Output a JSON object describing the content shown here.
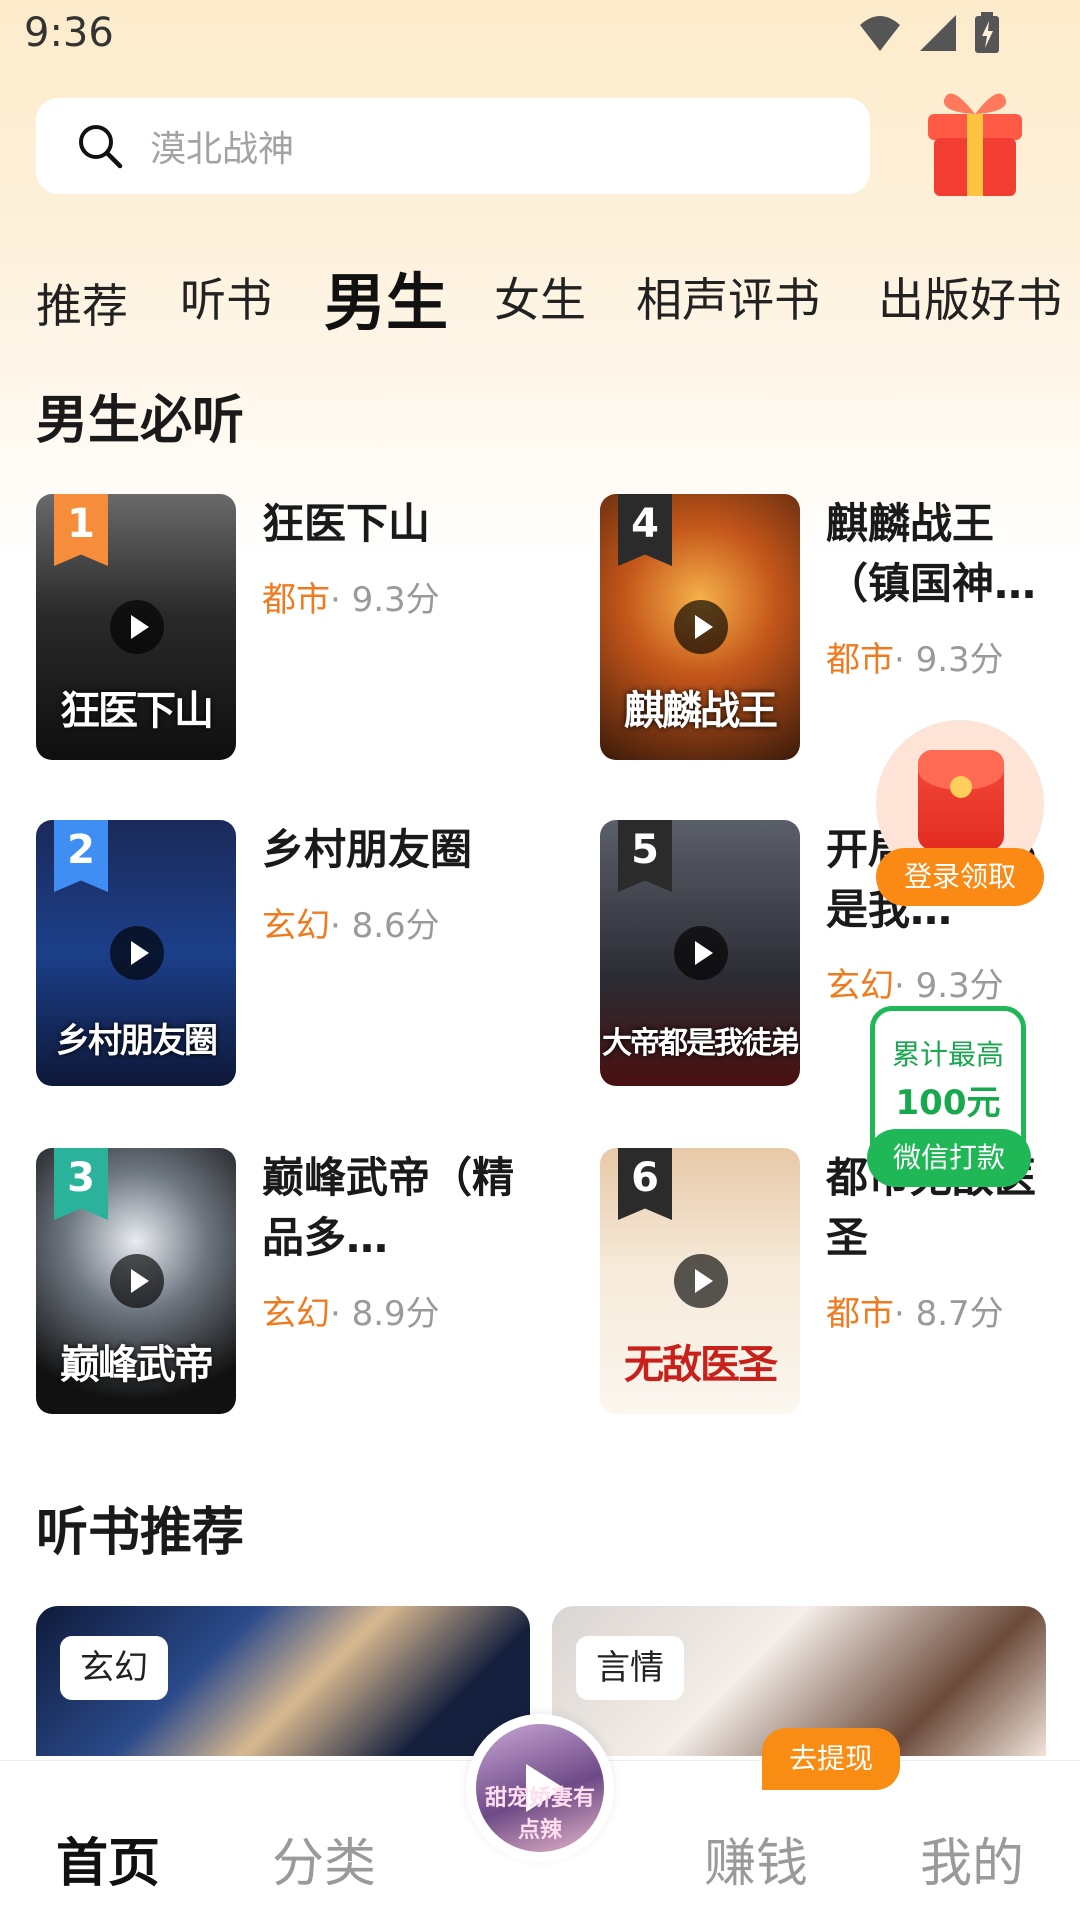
{
  "status_bar": {
    "time": "9:36"
  },
  "search": {
    "placeholder": "漠北战神"
  },
  "tabs": [
    "推荐",
    "听书",
    "男生",
    "女生",
    "相声评书",
    "出版好书"
  ],
  "active_tab": "男生",
  "section1": {
    "title": "男生必听",
    "books": [
      {
        "rank": "1",
        "title": "狂医下山",
        "genre": "都市",
        "score": "· 9.3分",
        "cover_text": "狂医下山"
      },
      {
        "rank": "4",
        "title": "麒麟战王（镇国神…",
        "genre": "都市",
        "score": "· 9.3分",
        "cover_text": "麒麟战王"
      },
      {
        "rank": "2",
        "title": "乡村朋友圈",
        "genre": "玄幻",
        "score": "· 8.6分",
        "cover_text": "乡村朋友圈"
      },
      {
        "rank": "5",
        "title": "开局大帝都是我…",
        "genre": "玄幻",
        "score": "· 9.3分",
        "cover_text": "大帝都是我徒弟"
      },
      {
        "rank": "3",
        "title": "巅峰武帝（精品多…",
        "genre": "玄幻",
        "score": "· 8.9分",
        "cover_text": "巅峰武帝"
      },
      {
        "rank": "6",
        "title": "都市无敌医圣",
        "genre": "都市",
        "score": "· 8.7分",
        "cover_text": "无敌医圣"
      }
    ]
  },
  "section2": {
    "title": "听书推荐",
    "cards": [
      {
        "tag": "玄幻"
      },
      {
        "tag": "言情"
      }
    ]
  },
  "floating": {
    "redpacket_label": "登录领取",
    "cash_line1": "累计最高",
    "cash_line2": "100元",
    "cash_button": "微信打款"
  },
  "bottom_nav": {
    "home": "首页",
    "category": "分类",
    "earn": "赚钱",
    "mine": "我的",
    "withdraw_badge": "去提现",
    "player_cover_text": "甜宠娇妻有点辣"
  },
  "colors": {
    "accent_orange": "#f07b1e",
    "green": "#20b757",
    "rank1": "#f58d3a",
    "rank2": "#3f8ef3",
    "rank3": "#2ab39a",
    "rank_other": "#2b2b2b"
  }
}
